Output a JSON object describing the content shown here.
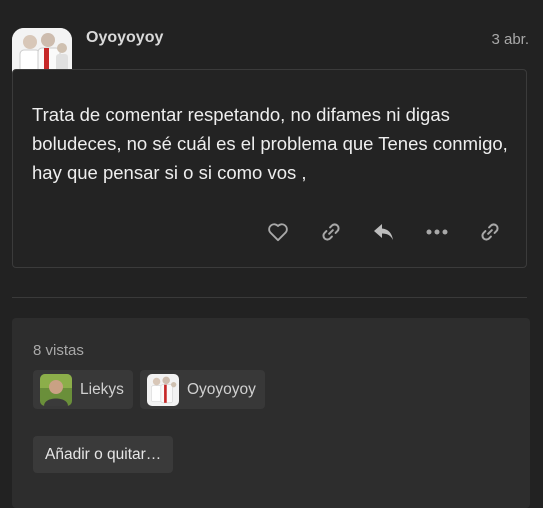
{
  "post": {
    "author": "Oyoyoyoy",
    "date": "3 abr.",
    "body": "Trata de comentar respetando, no difames ni digas boludeces, no sé cuál es el problema que Tenes conmigo, hay que pensar si o si como vos ,",
    "actions": [
      "heart-icon",
      "link-icon",
      "reply-icon",
      "more-icon",
      "link-icon"
    ]
  },
  "info": {
    "views": "8 vistas",
    "users": [
      {
        "name": "Liekys"
      },
      {
        "name": "Oyoyoyoy"
      }
    ],
    "add_label": "Añadir o quitar…"
  },
  "colors": {
    "background": "#222222",
    "panel": "#2d2d2d",
    "chip": "#383838",
    "text": "#eeeeee",
    "muted": "#a8a8a8"
  }
}
